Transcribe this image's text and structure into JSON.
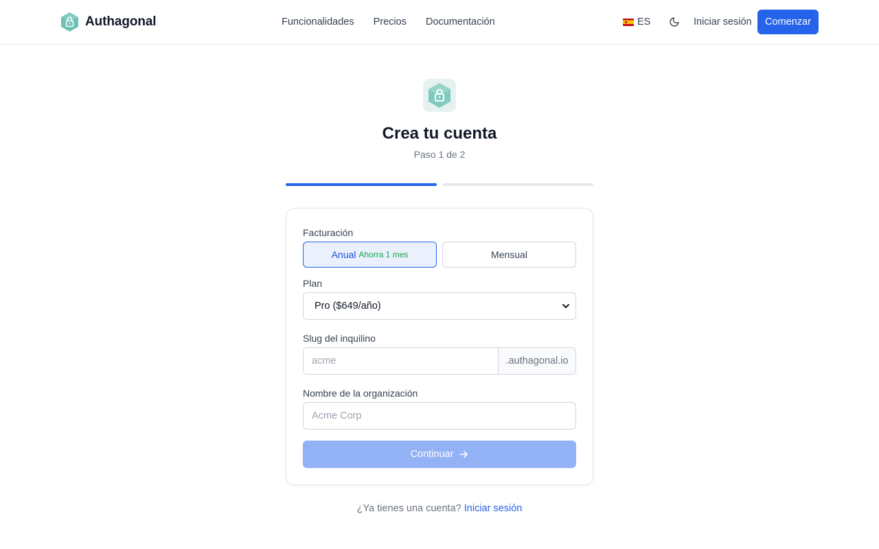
{
  "header": {
    "brand_name": "Authagonal",
    "nav": [
      {
        "label": "Funcionalidades"
      },
      {
        "label": "Precios"
      },
      {
        "label": "Documentación"
      }
    ],
    "language": "ES",
    "login_label": "Iniciar sesión",
    "cta_label": "Comenzar",
    "icons": {
      "brand": "hexagon-lock-logo",
      "flag": "spain-flag-icon",
      "theme": "moon-icon"
    }
  },
  "hero": {
    "title": "Crea tu cuenta",
    "step_text": "Paso 1 de 2",
    "steps_total": 2,
    "steps_completed": 1
  },
  "form": {
    "billing": {
      "label": "Facturación",
      "options": [
        {
          "label": "Anual",
          "badge": "Ahorra 1 mes",
          "selected": true
        },
        {
          "label": "Mensual",
          "badge": "",
          "selected": false
        }
      ]
    },
    "plan": {
      "label": "Plan",
      "selected": "Pro ($649/año)"
    },
    "slug": {
      "label": "Slug del inquilino",
      "placeholder": "acme",
      "value": "",
      "suffix": ".authagonal.io"
    },
    "organization": {
      "label": "Nombre de la organización",
      "placeholder": "Acme Corp",
      "value": ""
    },
    "submit_label": "Continuar",
    "submit_enabled": false
  },
  "footer": {
    "prompt": "¿Ya tienes una cuenta?",
    "link_label": "Iniciar sesión"
  },
  "colors": {
    "accent": "#2563eb",
    "accent_disabled": "#93b1f5",
    "brand_teal": "#5fb8ad",
    "success": "#16a34a"
  }
}
